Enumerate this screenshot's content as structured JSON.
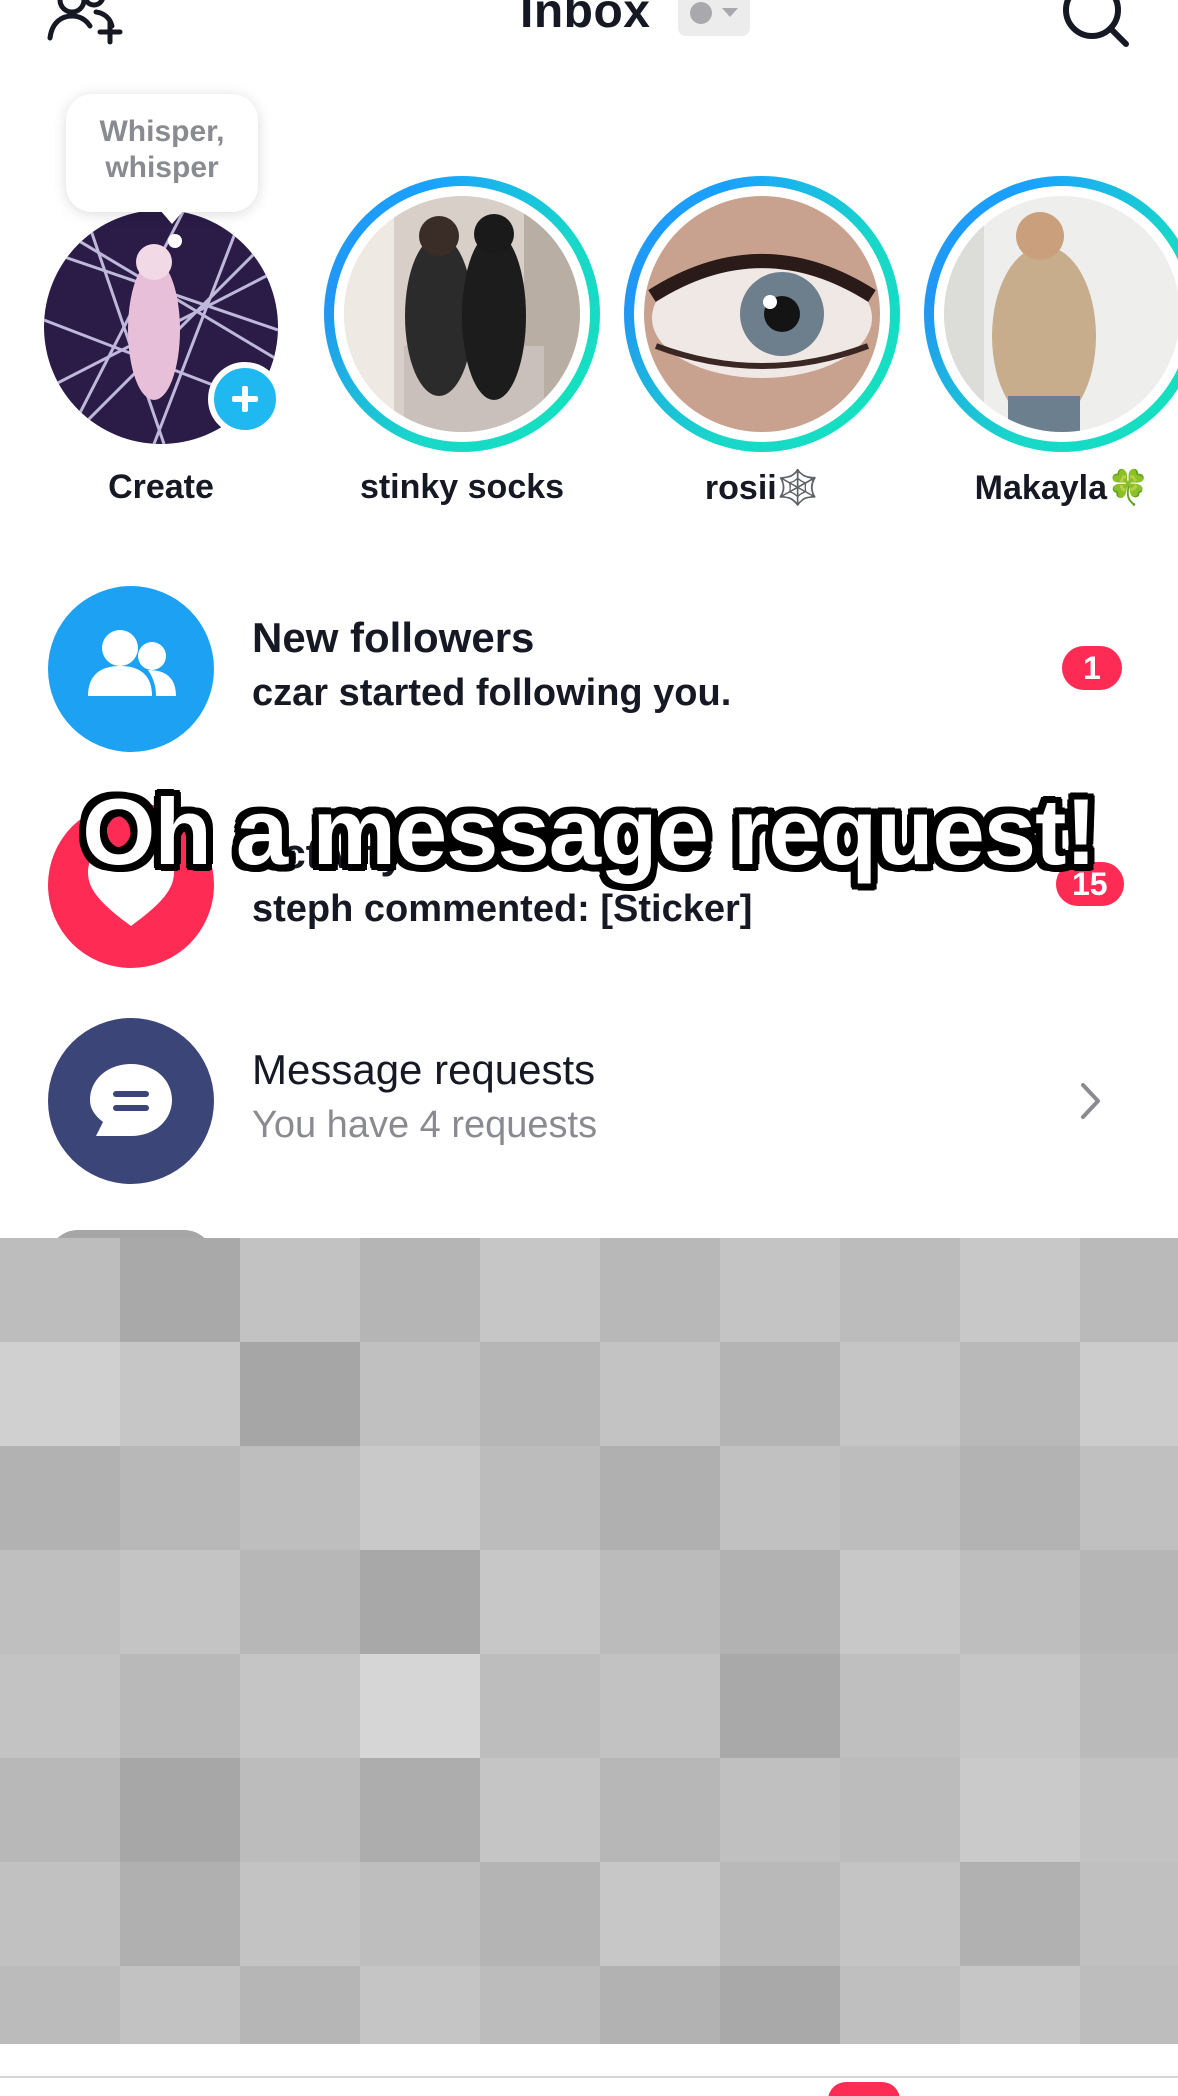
{
  "header": {
    "title": "Inbox",
    "add_friends_icon": "add-friends-icon",
    "search_icon": "search-icon",
    "status_color": "#a9a9ad"
  },
  "stories": {
    "whisper_bubble": [
      "Whisper,",
      "whisper"
    ],
    "items": [
      {
        "name": "Create",
        "icon": "plus-icon"
      },
      {
        "name": "stinky socks"
      },
      {
        "name": "rosii🕸️"
      },
      {
        "name": "Makayla🍀"
      }
    ],
    "ring_colors": [
      "#19d7c9",
      "#2196f3"
    ]
  },
  "rows": [
    {
      "title": "New followers",
      "subtitle": "czar started following you.",
      "badge": "1",
      "icon": "followers-icon",
      "color": "#1da1f2"
    },
    {
      "title": "Activity",
      "subtitle": "steph commented: [Sticker]",
      "badge": "15",
      "icon": "heart-icon",
      "color": "#fe2c55"
    },
    {
      "title": "Message requests",
      "subtitle": "You have 4 requests",
      "icon": "chat-bubble-icon",
      "color": "#3b4577"
    }
  ],
  "caption": "Oh a message request!",
  "colors": {
    "accent": "#fe2c55",
    "blue": "#20b8f0"
  }
}
